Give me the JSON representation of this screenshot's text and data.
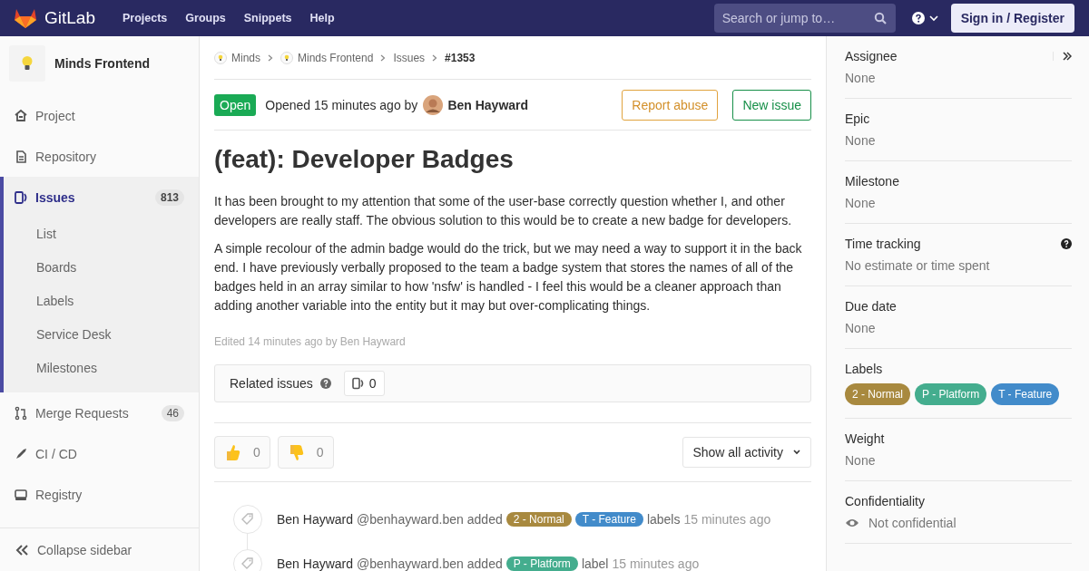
{
  "header": {
    "logo": "GitLab",
    "nav": [
      "Projects",
      "Groups",
      "Snippets",
      "Help"
    ],
    "search": {
      "placeholder": "Search or jump to…"
    },
    "sign_in": "Sign in / Register"
  },
  "sidebar": {
    "project": "Minds Frontend",
    "items": [
      {
        "label": "Project",
        "selected": false
      },
      {
        "label": "Repository",
        "selected": false
      },
      {
        "label": "Issues",
        "count": "813",
        "selected": true,
        "children": [
          {
            "label": "List",
            "selected": false
          },
          {
            "label": "Boards",
            "selected": false
          },
          {
            "label": "Labels",
            "selected": false
          },
          {
            "label": "Service Desk",
            "selected": false
          },
          {
            "label": "Milestones",
            "selected": false
          }
        ]
      },
      {
        "label": "Merge Requests",
        "count": "46",
        "selected": false
      },
      {
        "label": "CI / CD",
        "selected": false
      },
      {
        "label": "Registry",
        "selected": false
      }
    ],
    "collapse": "Collapse sidebar"
  },
  "breadcrumbs": [
    {
      "label": "Minds",
      "avatar": true
    },
    {
      "label": "Minds Frontend",
      "avatar": true
    },
    {
      "label": "Issues",
      "avatar": false
    },
    {
      "label": "#1353",
      "avatar": false
    }
  ],
  "issue": {
    "status": "Open",
    "opened": "Opened 15 minutes ago by",
    "author": "Ben Hayward",
    "actions": [
      {
        "label": "Report abuse",
        "kind": "warning"
      },
      {
        "label": "New issue",
        "kind": "success"
      }
    ],
    "title": "(feat): Developer Badges",
    "paragraphs": [
      "It has been brought to my attention that some of the user-base correctly question whether I, and other developers are really staff. The obvious solution to this would be to create a new badge for developers.",
      "A simple recolour of the admin badge would do the trick, but we may need a way to support it in the back end. I have previously verbally proposed to the team a badge system that stores the names of all of the badges held in an array similar to how 'nsfw' is handled - I feel this would be a cleaner approach than adding another variable into the entity but it may but over-complicating things."
    ],
    "edited": "Edited 14 minutes ago by Ben Hayward",
    "related": {
      "label": "Related issues",
      "count": "0"
    },
    "awards": [
      {
        "kind": "thumbsup",
        "count": "0"
      },
      {
        "kind": "thumbsdown",
        "count": "0"
      }
    ],
    "activity_filter": "Show all activity",
    "notes": [
      {
        "author": "Ben Hayward",
        "handle": "@benhayward.ben",
        "action": "added",
        "labels": [
          {
            "text": "2 - Normal",
            "color": "#a8893f"
          },
          {
            "text": "T - Feature",
            "color": "#428bca"
          }
        ],
        "suffix": "labels",
        "time": "15 minutes ago"
      },
      {
        "author": "Ben Hayward",
        "handle": "@benhayward.ben",
        "action": "added",
        "labels": [
          {
            "text": "P - Platform",
            "color": "#44ad8e"
          }
        ],
        "suffix": "label",
        "time": "15 minutes ago"
      }
    ]
  },
  "right_sidebar": {
    "blocks": [
      {
        "kind": "text",
        "title": "Assignee",
        "value": "None",
        "collapse": true
      },
      {
        "kind": "text",
        "title": "Epic",
        "value": "None"
      },
      {
        "kind": "text",
        "title": "Milestone",
        "value": "None"
      },
      {
        "kind": "text",
        "title": "Time tracking",
        "value": "No estimate or time spent",
        "help": true
      },
      {
        "kind": "text",
        "title": "Due date",
        "value": "None"
      },
      {
        "kind": "labels",
        "title": "Labels",
        "labels": [
          {
            "text": "2 - Normal",
            "color": "#a8893f"
          },
          {
            "text": "P - Platform",
            "color": "#44ad8e"
          },
          {
            "text": "T - Feature",
            "color": "#428bca"
          }
        ]
      },
      {
        "kind": "text",
        "title": "Weight",
        "value": "None"
      },
      {
        "kind": "eye",
        "title": "Confidentiality",
        "value": "Not confidential"
      }
    ]
  }
}
